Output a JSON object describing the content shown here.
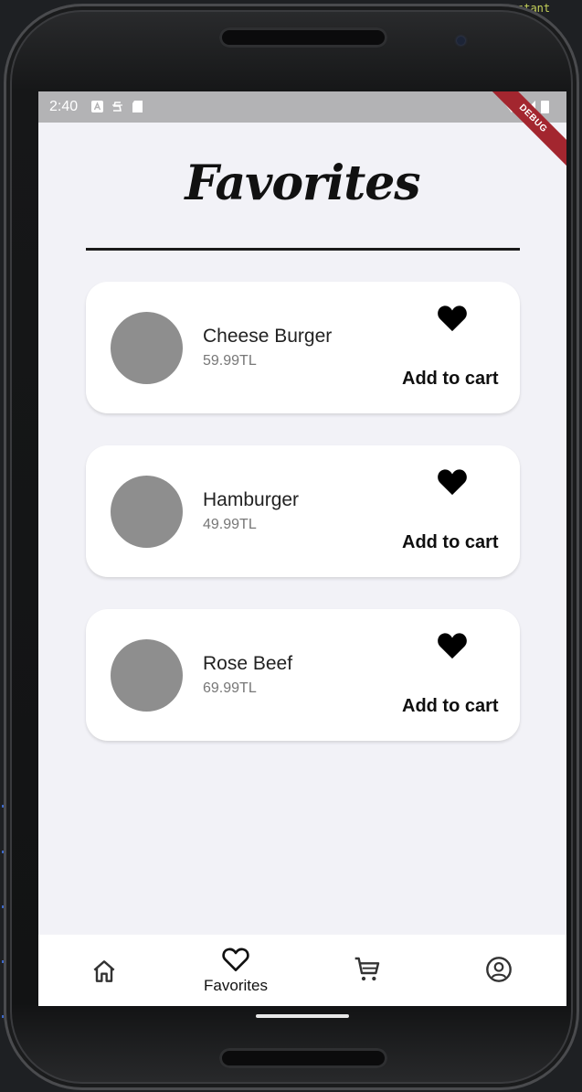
{
  "status_bar": {
    "time": "2:40",
    "debug_label": "DEBUG"
  },
  "editor": {
    "visible_text": "stant"
  },
  "page": {
    "title": "Favorites"
  },
  "favorites": [
    {
      "name": "Cheese Burger",
      "price": "59.99TL",
      "action_label": "Add to cart",
      "favorited": true
    },
    {
      "name": "Hamburger",
      "price": "49.99TL",
      "action_label": "Add to cart",
      "favorited": true
    },
    {
      "name": "Rose Beef",
      "price": "69.99TL",
      "action_label": "Add to cart",
      "favorited": true
    }
  ],
  "bottom_nav": {
    "items": [
      {
        "icon": "home-icon",
        "label": "",
        "active": false
      },
      {
        "icon": "heart-outline-icon",
        "label": "Favorites",
        "active": true
      },
      {
        "icon": "cart-icon",
        "label": "",
        "active": false
      },
      {
        "icon": "account-icon",
        "label": "",
        "active": false
      }
    ]
  },
  "colors": {
    "screen_background": "#f2f2f7",
    "card_background": "#ffffff",
    "avatar_placeholder": "#8e8e8e",
    "status_bar": "#b3b3b5",
    "debug_ribbon": "#a3262f"
  }
}
